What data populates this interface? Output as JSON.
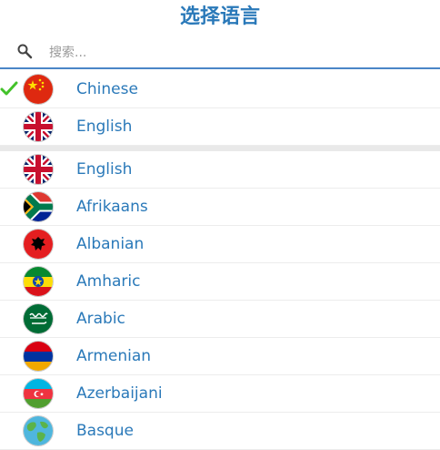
{
  "header": {
    "title": "选择语言"
  },
  "search": {
    "placeholder": "搜索..."
  },
  "selected_languages": [
    {
      "name": "Chinese",
      "checked": true
    },
    {
      "name": "English",
      "checked": false
    }
  ],
  "all_languages": [
    {
      "name": "English"
    },
    {
      "name": "Afrikaans"
    },
    {
      "name": "Albanian"
    },
    {
      "name": "Amharic"
    },
    {
      "name": "Arabic"
    },
    {
      "name": "Armenian"
    },
    {
      "name": "Azerbaijani"
    },
    {
      "name": "Basque"
    }
  ],
  "colors": {
    "accent": "#2a79b9",
    "check": "#43c22a",
    "divider": "#e9e9e9"
  }
}
